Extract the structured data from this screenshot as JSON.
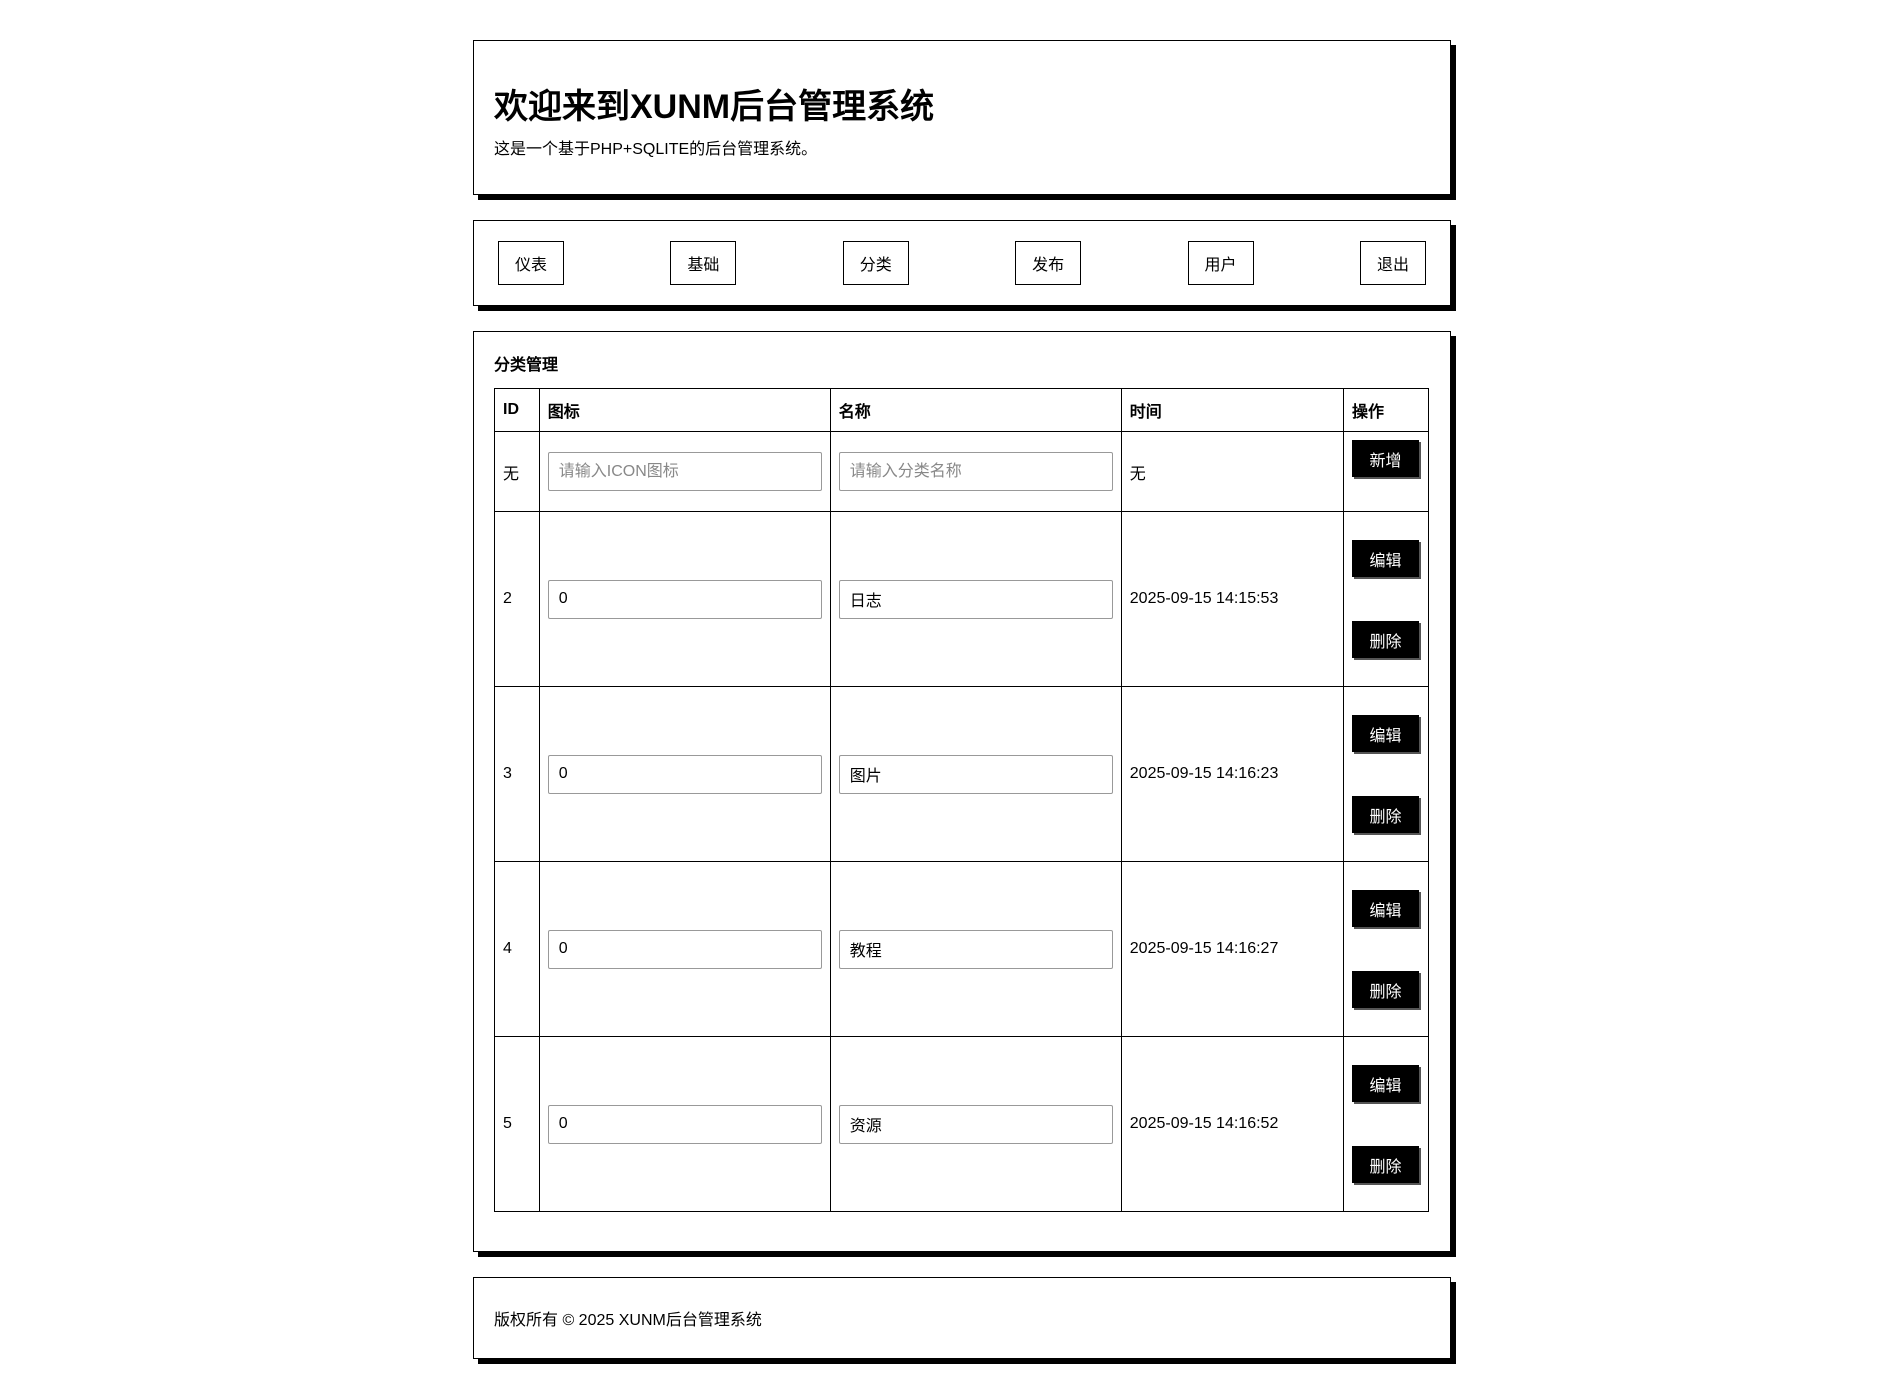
{
  "header": {
    "title": "欢迎来到XUNM后台管理系统",
    "subtitle": "这是一个基于PHP+SQLITE的后台管理系统。"
  },
  "nav": {
    "dashboard": "仪表",
    "basic": "基础",
    "category": "分类",
    "publish": "发布",
    "user": "用户",
    "logout": "退出"
  },
  "main": {
    "section_title": "分类管理",
    "columns": {
      "id": "ID",
      "icon": "图标",
      "name": "名称",
      "time": "时间",
      "ops": "操作"
    },
    "add_row": {
      "id": "无",
      "icon_placeholder": "请输入ICON图标",
      "name_placeholder": "请输入分类名称",
      "time": "无",
      "add_label": "新增"
    },
    "rows": [
      {
        "id": "2",
        "icon": "0",
        "name": "日志",
        "time": "2025-09-15 14:15:53"
      },
      {
        "id": "3",
        "icon": "0",
        "name": "图片",
        "time": "2025-09-15 14:16:23"
      },
      {
        "id": "4",
        "icon": "0",
        "name": "教程",
        "time": "2025-09-15 14:16:27"
      },
      {
        "id": "5",
        "icon": "0",
        "name": "资源",
        "time": "2025-09-15 14:16:52"
      }
    ],
    "edit_label": "编辑",
    "delete_label": "删除"
  },
  "footer": {
    "copyright": "版权所有 © 2025 XUNM后台管理系统"
  }
}
